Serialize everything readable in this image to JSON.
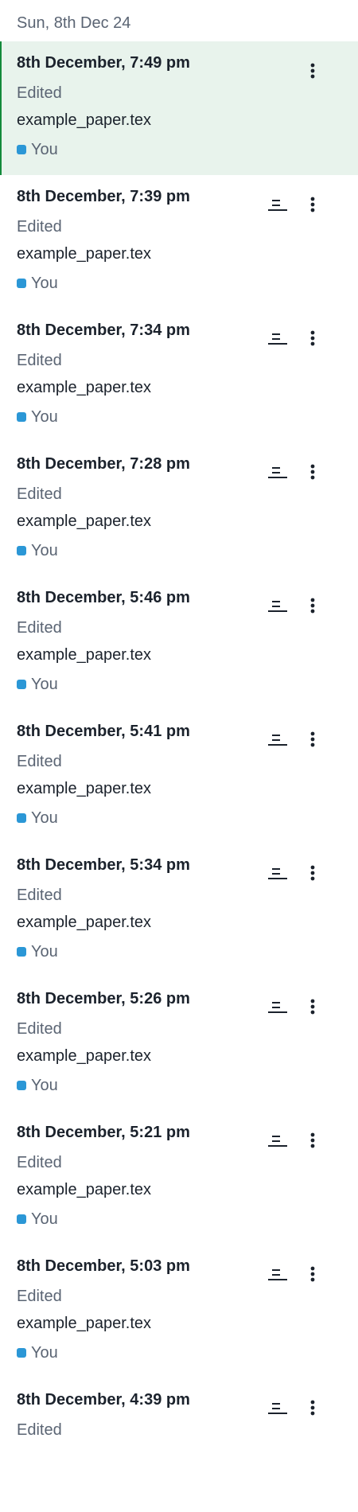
{
  "history": {
    "day_label": "Sun, 8th Dec 24",
    "entries": [
      {
        "time": "8th December, 7:49 pm",
        "action": "Edited",
        "file": "example_paper.tex",
        "user": "You"
      },
      {
        "time": "8th December, 7:39 pm",
        "action": "Edited",
        "file": "example_paper.tex",
        "user": "You"
      },
      {
        "time": "8th December, 7:34 pm",
        "action": "Edited",
        "file": "example_paper.tex",
        "user": "You"
      },
      {
        "time": "8th December, 7:28 pm",
        "action": "Edited",
        "file": "example_paper.tex",
        "user": "You"
      },
      {
        "time": "8th December, 5:46 pm",
        "action": "Edited",
        "file": "example_paper.tex",
        "user": "You"
      },
      {
        "time": "8th December, 5:41 pm",
        "action": "Edited",
        "file": "example_paper.tex",
        "user": "You"
      },
      {
        "time": "8th December, 5:34 pm",
        "action": "Edited",
        "file": "example_paper.tex",
        "user": "You"
      },
      {
        "time": "8th December, 5:26 pm",
        "action": "Edited",
        "file": "example_paper.tex",
        "user": "You"
      },
      {
        "time": "8th December, 5:21 pm",
        "action": "Edited",
        "file": "example_paper.tex",
        "user": "You"
      },
      {
        "time": "8th December, 5:03 pm",
        "action": "Edited",
        "file": "example_paper.tex",
        "user": "You"
      },
      {
        "time": "8th December, 4:39 pm",
        "action": "Edited",
        "file": "",
        "user": ""
      }
    ]
  },
  "colors": {
    "selected_bg": "#e8f3ec",
    "selected_border": "#138a3b",
    "user_badge": "#2b97d6",
    "muted_text": "#5a6473"
  },
  "icons": {
    "compare": "compare-versions-icon",
    "more": "more-vertical-icon"
  }
}
